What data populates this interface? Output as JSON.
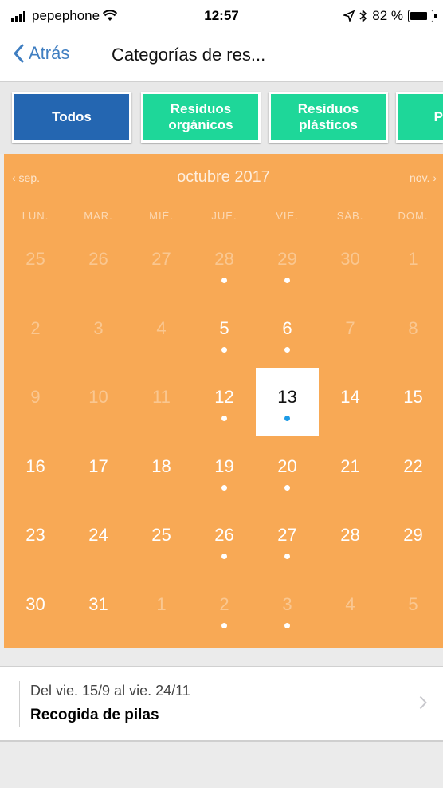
{
  "status": {
    "carrier": "pepephone",
    "time": "12:57",
    "battery": "82 %",
    "battery_level": 0.82
  },
  "nav": {
    "back_label": "Atrás",
    "title": "Categorías de res..."
  },
  "chips": [
    {
      "line1": "Todos",
      "line2": ""
    },
    {
      "line1": "Residuos",
      "line2": "orgánicos"
    },
    {
      "line1": "Residuos",
      "line2": "plásticos"
    },
    {
      "line1": "P",
      "line2": ""
    }
  ],
  "calendar": {
    "prev_month": "‹ sep.",
    "month_label": "octubre 2017",
    "next_month": "nov. ›",
    "weekdays": [
      "LUN.",
      "MAR.",
      "MIÉ.",
      "JUE.",
      "VIE.",
      "SÁB.",
      "DOM."
    ],
    "weeks": [
      [
        {
          "d": "25",
          "in": false,
          "dot": false
        },
        {
          "d": "26",
          "in": false,
          "dot": false
        },
        {
          "d": "27",
          "in": false,
          "dot": false
        },
        {
          "d": "28",
          "in": false,
          "dot": true
        },
        {
          "d": "29",
          "in": false,
          "dot": true
        },
        {
          "d": "30",
          "in": false,
          "dot": false
        },
        {
          "d": "1",
          "in": false,
          "dot": false
        }
      ],
      [
        {
          "d": "2",
          "in": false,
          "dot": false
        },
        {
          "d": "3",
          "in": false,
          "dot": false
        },
        {
          "d": "4",
          "in": false,
          "dot": false
        },
        {
          "d": "5",
          "in": true,
          "dot": true
        },
        {
          "d": "6",
          "in": true,
          "dot": true
        },
        {
          "d": "7",
          "in": false,
          "dot": false
        },
        {
          "d": "8",
          "in": false,
          "dot": false
        }
      ],
      [
        {
          "d": "9",
          "in": false,
          "dot": false
        },
        {
          "d": "10",
          "in": false,
          "dot": false
        },
        {
          "d": "11",
          "in": false,
          "dot": false
        },
        {
          "d": "12",
          "in": true,
          "dot": true
        },
        {
          "d": "13",
          "in": true,
          "dot": true,
          "selected": true
        },
        {
          "d": "14",
          "in": true,
          "dot": false
        },
        {
          "d": "15",
          "in": true,
          "dot": false
        }
      ],
      [
        {
          "d": "16",
          "in": true,
          "dot": false
        },
        {
          "d": "17",
          "in": true,
          "dot": false
        },
        {
          "d": "18",
          "in": true,
          "dot": false
        },
        {
          "d": "19",
          "in": true,
          "dot": true
        },
        {
          "d": "20",
          "in": true,
          "dot": true
        },
        {
          "d": "21",
          "in": true,
          "dot": false
        },
        {
          "d": "22",
          "in": true,
          "dot": false
        }
      ],
      [
        {
          "d": "23",
          "in": true,
          "dot": false
        },
        {
          "d": "24",
          "in": true,
          "dot": false
        },
        {
          "d": "25",
          "in": true,
          "dot": false
        },
        {
          "d": "26",
          "in": true,
          "dot": true
        },
        {
          "d": "27",
          "in": true,
          "dot": true
        },
        {
          "d": "28",
          "in": true,
          "dot": false
        },
        {
          "d": "29",
          "in": true,
          "dot": false
        }
      ],
      [
        {
          "d": "30",
          "in": true,
          "dot": false
        },
        {
          "d": "31",
          "in": true,
          "dot": false
        },
        {
          "d": "1",
          "in": false,
          "dot": false
        },
        {
          "d": "2",
          "in": false,
          "dot": true
        },
        {
          "d": "3",
          "in": false,
          "dot": true
        },
        {
          "d": "4",
          "in": false,
          "dot": false
        },
        {
          "d": "5",
          "in": false,
          "dot": false
        }
      ]
    ]
  },
  "event": {
    "date_range": "Del vie. 15/9 al vie. 24/11",
    "title": "Recogida de pilas"
  },
  "colors": {
    "calendar_bg": "#f8a955",
    "chip_active": "#2466b1",
    "chip_green": "#1ed799",
    "link_blue": "#3f7ec1",
    "selected_dot": "#1e9be6"
  }
}
